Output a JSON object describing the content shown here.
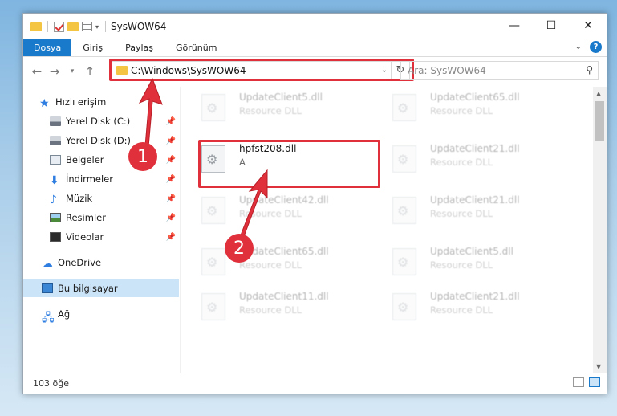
{
  "window": {
    "title": "SysWOW64"
  },
  "ribbon": {
    "tabs": [
      "Dosya",
      "Giriş",
      "Paylaş",
      "Görünüm"
    ]
  },
  "address": {
    "path": "C:\\Windows\\SysWOW64"
  },
  "search": {
    "placeholder": "Ara: SysWOW64"
  },
  "sidebar": {
    "items": [
      {
        "label": "Hızlı erişim",
        "icon": "star-icon",
        "pinned": false
      },
      {
        "label": "Yerel Disk (C:)",
        "icon": "disk-icon",
        "pinned": true
      },
      {
        "label": "Yerel Disk (D:)",
        "icon": "disk-icon",
        "pinned": true
      },
      {
        "label": "Belgeler",
        "icon": "documents-icon",
        "pinned": true
      },
      {
        "label": "İndirmeler",
        "icon": "download-icon",
        "pinned": true
      },
      {
        "label": "Müzik",
        "icon": "music-icon",
        "pinned": true
      },
      {
        "label": "Resimler",
        "icon": "pictures-icon",
        "pinned": true
      },
      {
        "label": "Videolar",
        "icon": "videos-icon",
        "pinned": true
      },
      {
        "label": "OneDrive",
        "icon": "cloud-icon",
        "pinned": false
      },
      {
        "label": "Bu bilgisayar",
        "icon": "computer-icon",
        "pinned": false
      },
      {
        "label": "Ağ",
        "icon": "network-icon",
        "pinned": false
      }
    ]
  },
  "files": {
    "highlighted": {
      "name": "hpfst208.dll",
      "type": "A"
    },
    "left_column": [
      {
        "name": "UpdateClient5.dll",
        "type": "Resource DLL"
      },
      {
        "name": "UpdateClient42.dll",
        "type": "Resource DLL"
      },
      {
        "name": "UpdateClient65.dll",
        "type": "Resource DLL"
      },
      {
        "name": "UpdateClient11.dll",
        "type": "Resource DLL"
      }
    ],
    "right_column": [
      {
        "name": "UpdateClient65.dll",
        "type": "Resource DLL"
      },
      {
        "name": "UpdateClient21.dll",
        "type": "Resource DLL"
      },
      {
        "name": "UpdateClient21.dll",
        "type": "Resource DLL"
      },
      {
        "name": "UpdateClient5.dll",
        "type": "Resource DLL"
      },
      {
        "name": "UpdateClient21.dll",
        "type": "Resource DLL"
      }
    ]
  },
  "status": {
    "count": "103 öğe"
  },
  "markers": {
    "one": "1",
    "two": "2"
  },
  "colors": {
    "accent": "#1979ca",
    "annotation": "#e0303b"
  }
}
